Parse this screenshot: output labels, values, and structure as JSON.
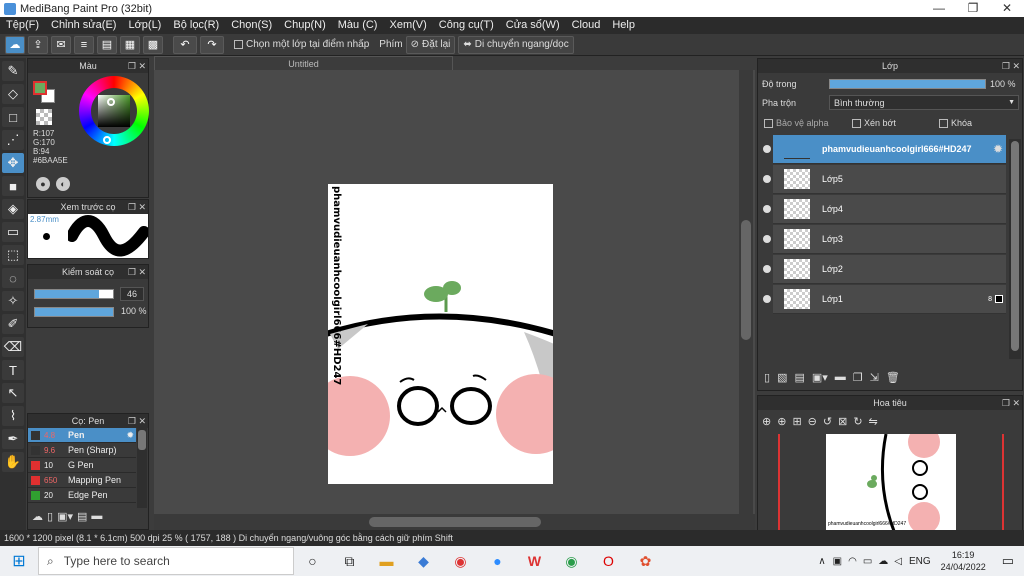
{
  "window": {
    "title": "MediBang Paint Pro (32bit)"
  },
  "menu": [
    "Tệp(F)",
    "Chỉnh sửa(E)",
    "Lớp(L)",
    "Bộ lọc(R)",
    "Chọn(S)",
    "Chụp(N)",
    "Màu (C)",
    "Xem(V)",
    "Công cụ(T)",
    "Cửa sổ(W)",
    "Cloud",
    "Help"
  ],
  "toolbar": {
    "select_one_layer": "Chọn một lớp tại điểm nhấp",
    "phim_label": "Phím",
    "reset": "Đặt lại",
    "move_hv": "Di chuyển ngang/dọc"
  },
  "document": {
    "tab": "Untitled",
    "vertical_text": "phamvudieuanhcoolgirl666#HD247"
  },
  "color_panel": {
    "title": "Màu",
    "r": "R:107",
    "g": "G:170",
    "b": "B:94",
    "hex": "#6BAA5E",
    "fg": "#6BAA5E",
    "bg": "#ffffff"
  },
  "preview_panel": {
    "title": "Xem trước cọ",
    "size": "2.87mm"
  },
  "brush_control": {
    "title": "Kiểm soát cọ",
    "size": "46",
    "opacity": "100 %",
    "opacity_fraction": 1.0,
    "size_fraction": 0.82
  },
  "brush_panel": {
    "title": "Cọ: Pen",
    "items": [
      {
        "size": "4.8",
        "name": "Pen",
        "color": "#333333"
      },
      {
        "size": "9.6",
        "name": "Pen (Sharp)",
        "color": "#333333"
      },
      {
        "size": "10",
        "name": "G Pen",
        "color": "#e03030"
      },
      {
        "size": "650",
        "name": "Mapping Pen",
        "color": "#e03030"
      },
      {
        "size": "20",
        "name": "Edge Pen",
        "color": "#30a030"
      }
    ]
  },
  "layer_panel": {
    "title": "Lớp",
    "opacity_label": "Độ trong",
    "opacity_value": "100 %",
    "opacity_fraction": 1.0,
    "blend_label": "Pha trộn",
    "blend_value": "Bình thường",
    "protect_alpha": "Bảo vệ alpha",
    "clipping": "Xén bớt",
    "lock": "Khóa",
    "layers": [
      "phamvudieuanhcoolgirl666#HD247",
      "Lớp5",
      "Lớp4",
      "Lớp3",
      "Lớp2",
      "Lớp1"
    ],
    "layer1_badge": "8"
  },
  "navigator": {
    "title": "Hoa tiêu"
  },
  "status": {
    "text": "1600 * 1200 pixel   (8.1 * 6.1cm)   500 dpi   25 %   ( 1757, 188 )   Di chuyển ngang/vuông góc bằng cách giữ phím Shift"
  },
  "taskbar": {
    "search_placeholder": "Type here to search",
    "lang": "ENG",
    "time": "16:19",
    "date": "24/04/2022"
  }
}
